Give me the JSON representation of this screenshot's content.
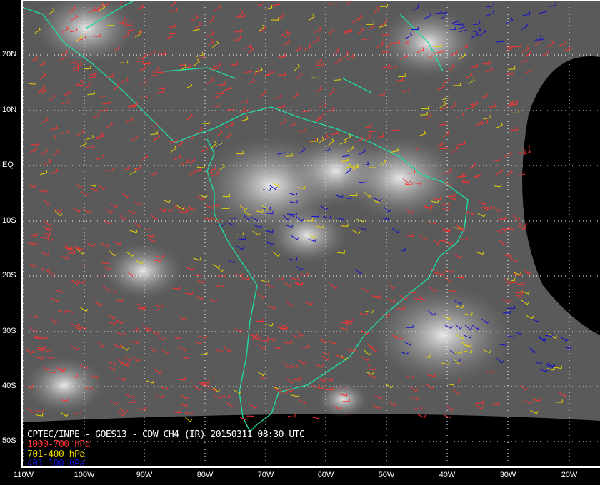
{
  "title": "CPTEC/INPE - GOES13 - CDW CH4 (IR) 20150311 08:30 UTC",
  "legend": [
    {
      "label": "1000-700 hPa",
      "color": "#ff3030"
    },
    {
      "label": "701-400 hPa",
      "color": "#e6d200"
    },
    {
      "label": "401-100 hPa",
      "color": "#1010d0"
    }
  ],
  "lat_labels": [
    "20N",
    "10N",
    "EQ",
    "10S",
    "20S",
    "30S",
    "40S",
    "50S"
  ],
  "lon_labels": [
    "110W",
    "100W",
    "90W",
    "80W",
    "70W",
    "60W",
    "50W",
    "40W",
    "30W",
    "20W"
  ],
  "colors": {
    "coast": "#20d8a0",
    "frame": "#ffffff",
    "grid": "#ffffff"
  }
}
